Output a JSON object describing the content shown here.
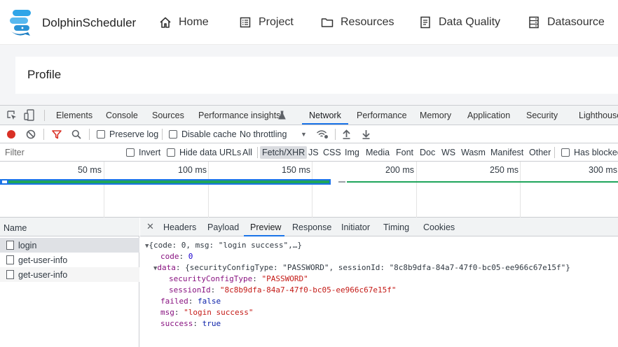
{
  "app": {
    "logo_text": "DolphinScheduler",
    "nav": [
      {
        "label": "Home",
        "icon": "home-icon"
      },
      {
        "label": "Project",
        "icon": "project-icon"
      },
      {
        "label": "Resources",
        "icon": "folder-icon"
      },
      {
        "label": "Data Quality",
        "icon": "document-icon"
      },
      {
        "label": "Datasource",
        "icon": "database-icon"
      }
    ],
    "profile_title": "Profile"
  },
  "devtools": {
    "tabs": [
      "Elements",
      "Console",
      "Sources",
      "Performance insights",
      "Network",
      "Performance",
      "Memory",
      "Application",
      "Security",
      "Lighthouse"
    ],
    "active_tab": "Network",
    "toolbar": {
      "preserve_log": "Preserve log",
      "disable_cache": "Disable cache",
      "throttling": "No throttling"
    },
    "filter": {
      "placeholder": "Filter",
      "invert": "Invert",
      "hide_data_urls": "Hide data URLs",
      "types": [
        "All",
        "Fetch/XHR",
        "JS",
        "CSS",
        "Img",
        "Media",
        "Font",
        "Doc",
        "WS",
        "Wasm",
        "Manifest",
        "Other"
      ],
      "active_type": "Fetch/XHR",
      "has_blocked": "Has blocked"
    },
    "timeline": {
      "ticks": [
        "50 ms",
        "100 ms",
        "150 ms",
        "200 ms",
        "250 ms",
        "300 ms"
      ]
    },
    "requests": {
      "header": "Name",
      "rows": [
        "login",
        "get-user-info",
        "get-user-info"
      ]
    },
    "details": {
      "tabs": [
        "Headers",
        "Payload",
        "Preview",
        "Response",
        "Initiator",
        "Timing",
        "Cookies"
      ],
      "active_tab": "Preview"
    },
    "preview": {
      "summary": "{code: 0, msg: \"login success\",…}",
      "code_key": "code",
      "code_val": "0",
      "data_key": "data",
      "data_summary": "{securityConfigType: \"PASSWORD\", sessionId: \"8c8b9dfa-84a7-47f0-bc05-ee966c67e15f\"}",
      "sct_key": "securityConfigType",
      "sct_val": "\"PASSWORD\"",
      "sid_key": "sessionId",
      "sid_val": "\"8c8b9dfa-84a7-47f0-bc05-ee966c67e15f\"",
      "failed_key": "failed",
      "failed_val": "false",
      "msg_key": "msg",
      "msg_val": "\"login success\"",
      "success_key": "success",
      "success_val": "true"
    },
    "colors": {
      "accent": "#1a73e8",
      "record": "#d93025",
      "filter_active": "#d93025",
      "waterfall_green": "#1fa55b",
      "waterfall_blue": "#1a73e8"
    }
  }
}
